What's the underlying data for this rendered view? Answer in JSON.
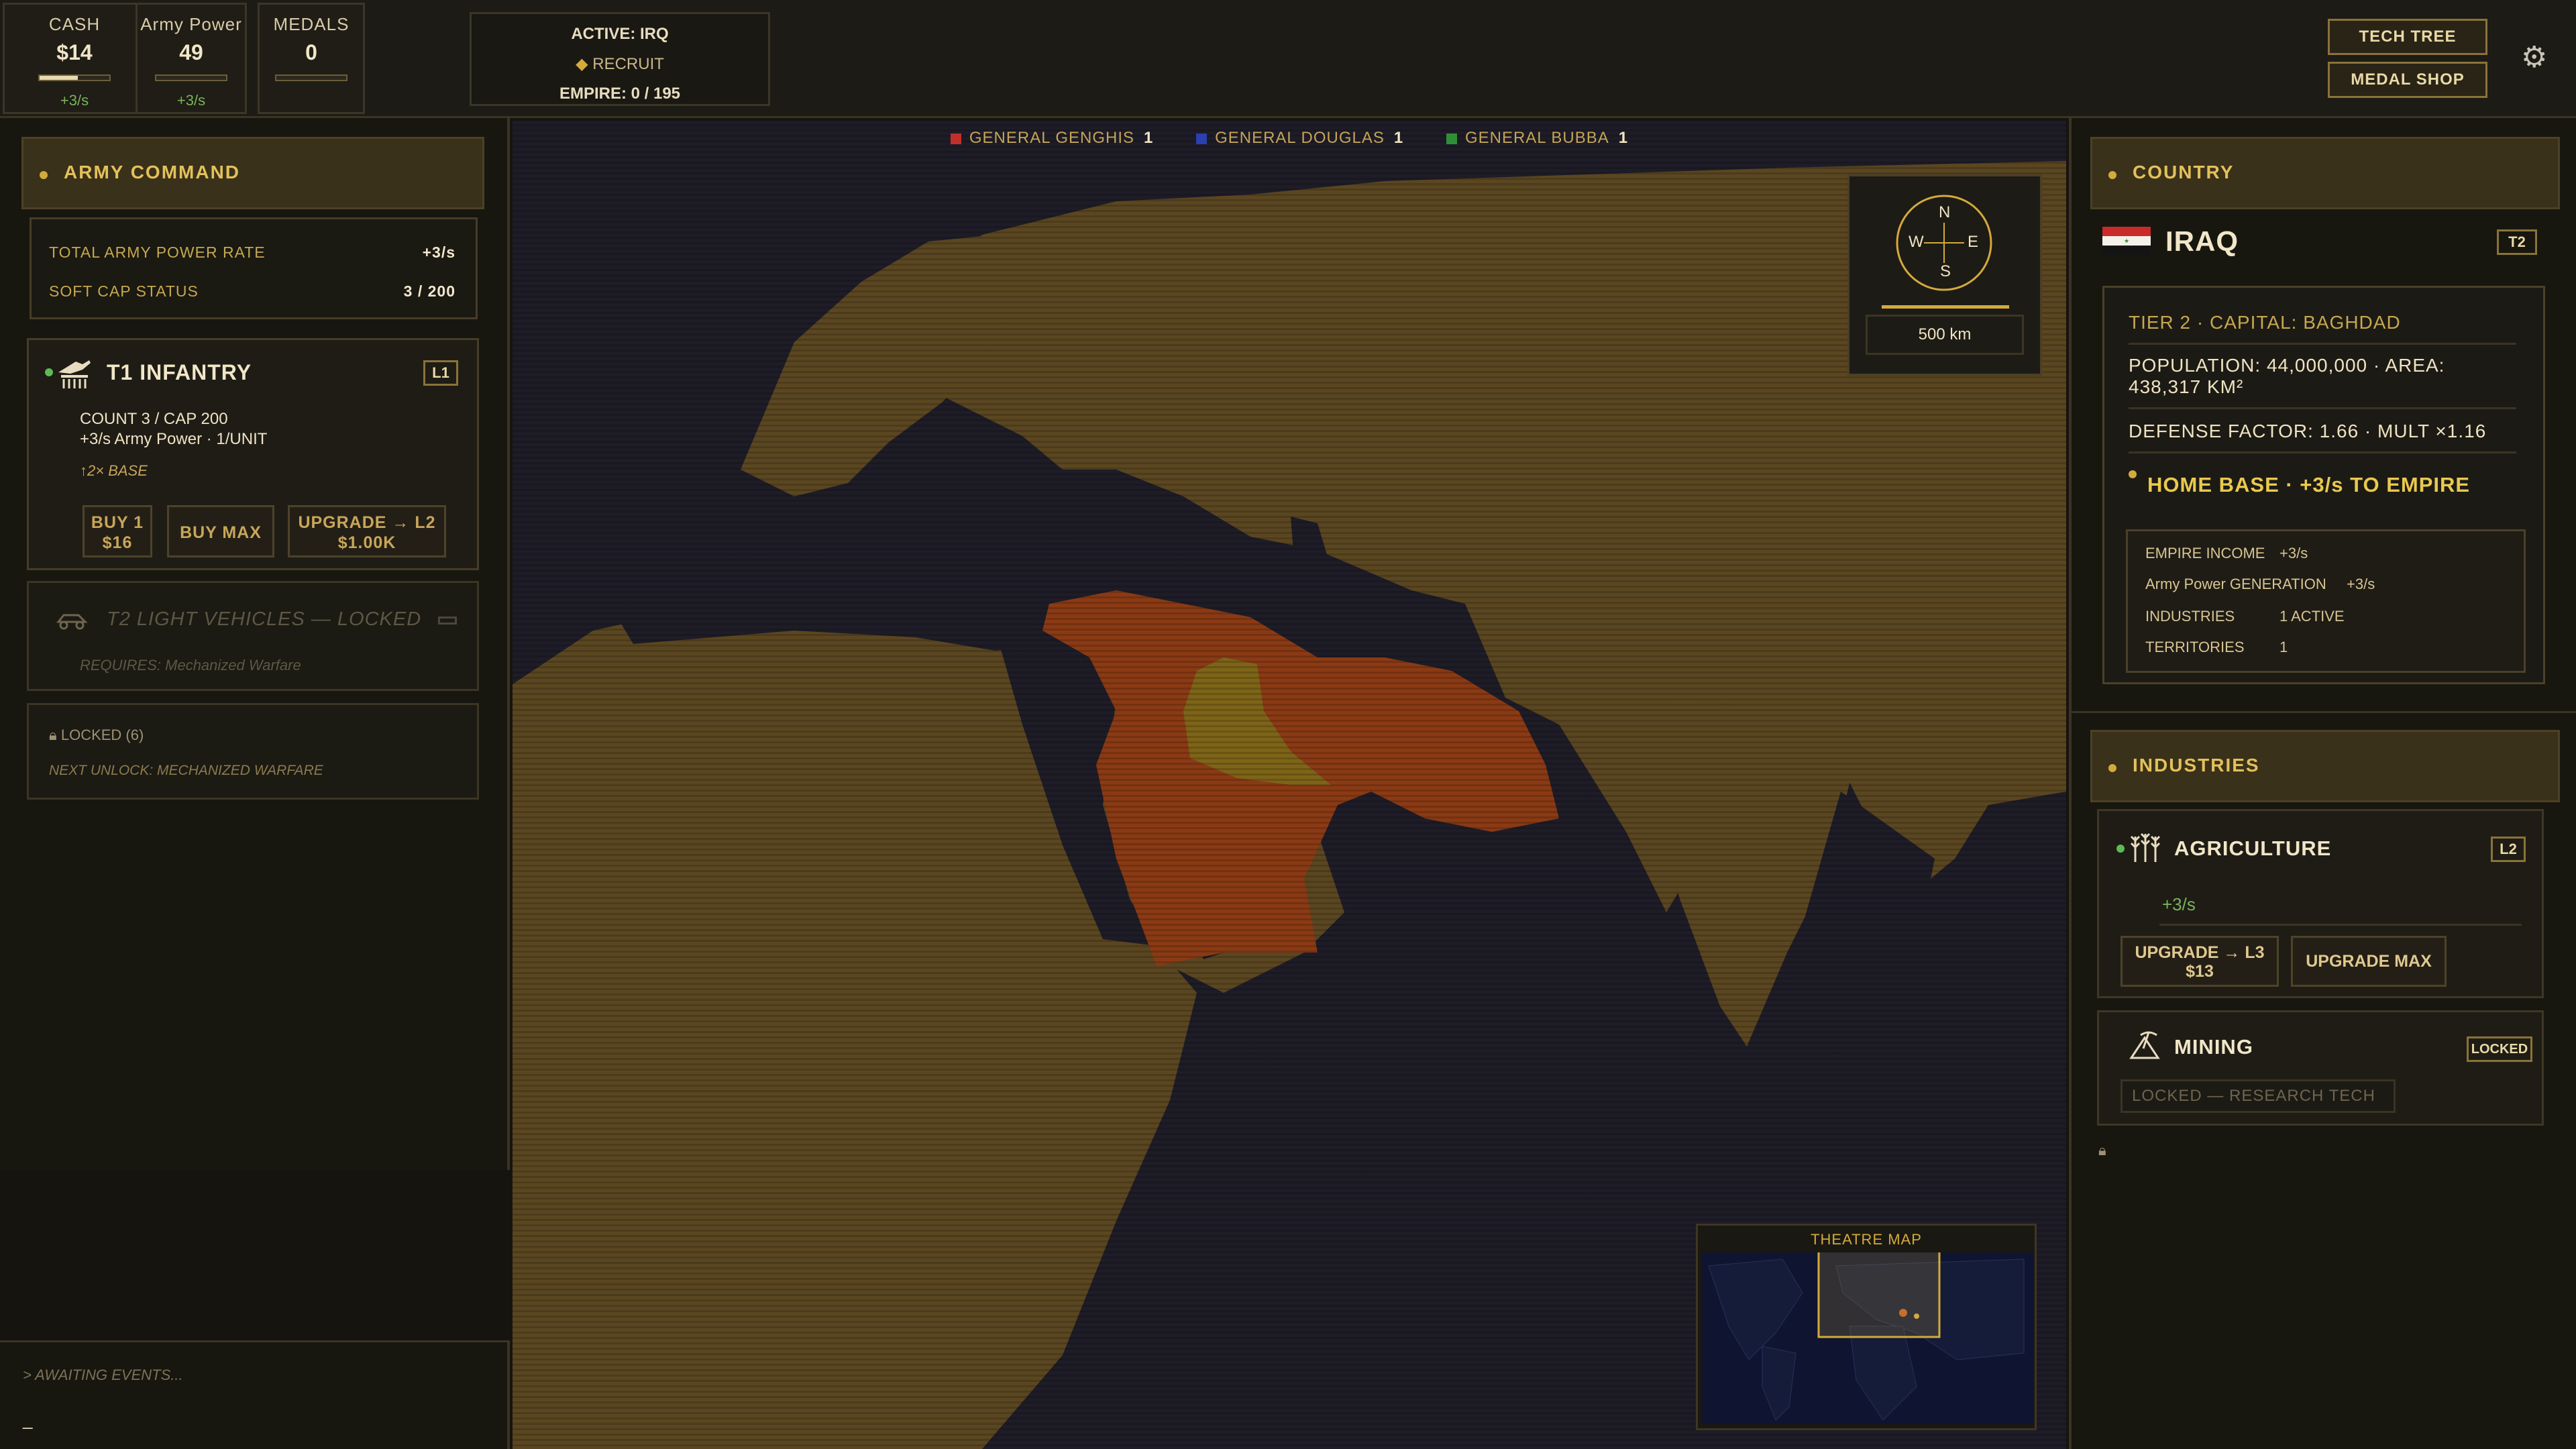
{
  "topbar": {
    "stats": [
      {
        "label": "CASH",
        "value": "$14",
        "rate": "+3/s",
        "fill": 0.55
      },
      {
        "label": "Army Power",
        "value": "49",
        "rate": "+3/s",
        "fill": 0.0
      },
      {
        "label": "MEDALS",
        "value": "0",
        "rate": "",
        "fill": 0.0
      }
    ],
    "active": {
      "line1": "ACTIVE: IRQ",
      "recruit": "RECRUIT",
      "empire": "EMPIRE: 0 / 195"
    },
    "tech_tree": "TECH TREE",
    "medal_shop": "MEDAL SHOP",
    "settings_icon": "gear-icon"
  },
  "left": {
    "header": "ARMY COMMAND",
    "rate_rows": [
      {
        "label": "TOTAL ARMY POWER RATE",
        "value": "+3/s"
      },
      {
        "label": "SOFT CAP STATUS",
        "value": "3 / 200"
      }
    ],
    "infantry": {
      "title": "T1 INFANTRY",
      "level": "L1",
      "count": "COUNT 3 / CAP 200",
      "power": "+3/s Army Power  ·  1/UNIT",
      "bonus": "↑2× BASE",
      "buy1_label": "BUY 1",
      "buy1_price": "$16",
      "buymax": "BUY MAX",
      "upgrade_label": "UPGRADE → L2",
      "upgrade_price": "$1.00K"
    },
    "vehicles": {
      "title": "T2 LIGHT VEHICLES — LOCKED",
      "requires": "REQUIRES: Mechanized Warfare"
    },
    "locked": {
      "title": "LOCKED (6)",
      "next": "NEXT UNLOCK: MECHANIZED WARFARE"
    },
    "console": {
      "line": "> AWAITING EVENTS...",
      "cursor": "_"
    }
  },
  "map": {
    "generals": [
      {
        "name": "GENERAL GENGHIS",
        "count": "1",
        "color": "#c0302a"
      },
      {
        "name": "GENERAL DOUGLAS",
        "count": "1",
        "color": "#2a3fb0"
      },
      {
        "name": "GENERAL BUBBA",
        "count": "1",
        "color": "#2f8f36"
      }
    ],
    "compass": {
      "n": "N",
      "s": "S",
      "e": "E",
      "w": "W",
      "scale": "500 km"
    },
    "theatre_title": "THEATRE MAP",
    "colors": {
      "land": "#5a4620",
      "sea": "#1e1c27",
      "owned_other": "#8a3a14",
      "selected": "#7d6418"
    }
  },
  "right": {
    "header": "COUNTRY",
    "country": {
      "name": "IRAQ",
      "tier_badge": "T2",
      "line1": "TIER 2  ·  CAPITAL: BAGHDAD",
      "line2a": "POPULATION: 44,000,000  ·  AREA:",
      "line2b": "438,317 KM²",
      "line3": "DEFENSE FACTOR: 1.66  ·  MULT ×1.16",
      "home": "HOME BASE  ·  +3/s TO EMPIRE",
      "empire_rows": [
        {
          "label": "EMPIRE INCOME",
          "value": "+3/s"
        },
        {
          "label": "Army Power GENERATION",
          "value": "+3/s"
        },
        {
          "label": "INDUSTRIES",
          "value": "1 ACTIVE"
        },
        {
          "label": "TERRITORIES",
          "value": "1"
        }
      ]
    },
    "industries_header": "INDUSTRIES",
    "agriculture": {
      "title": "AGRICULTURE",
      "level": "L2",
      "rate": "+3/s",
      "upgrade_label": "UPGRADE → L3",
      "upgrade_price": "$13",
      "upgrade_max": "UPGRADE MAX"
    },
    "mining": {
      "title": "MINING",
      "badge": "LOCKED",
      "note": "LOCKED — RESEARCH TECH"
    }
  }
}
